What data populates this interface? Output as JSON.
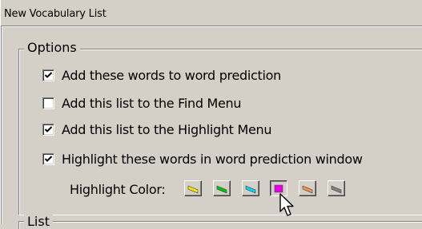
{
  "window": {
    "title": "New Vocabulary List"
  },
  "options_group": {
    "legend": "Options",
    "checkboxes": [
      {
        "label": "Add these words to word prediction",
        "checked": true
      },
      {
        "label": "Add this list to the Find Menu",
        "checked": false
      },
      {
        "label": "Add this list to the Highlight Menu",
        "checked": true
      },
      {
        "label": "Highlight these words in word prediction window",
        "checked": true
      }
    ],
    "highlight_color_label": "Highlight Color:",
    "highlight_colors": [
      {
        "name": "yellow",
        "color": "#f5e600",
        "selected": false
      },
      {
        "name": "green",
        "color": "#00c800",
        "selected": false
      },
      {
        "name": "cyan",
        "color": "#00d8f0",
        "selected": false
      },
      {
        "name": "magenta",
        "color": "#e600e6",
        "selected": true
      },
      {
        "name": "orange",
        "color": "#f89050",
        "selected": false
      },
      {
        "name": "gray",
        "color": "#808080",
        "selected": false
      }
    ]
  },
  "list_group": {
    "legend": "List"
  }
}
